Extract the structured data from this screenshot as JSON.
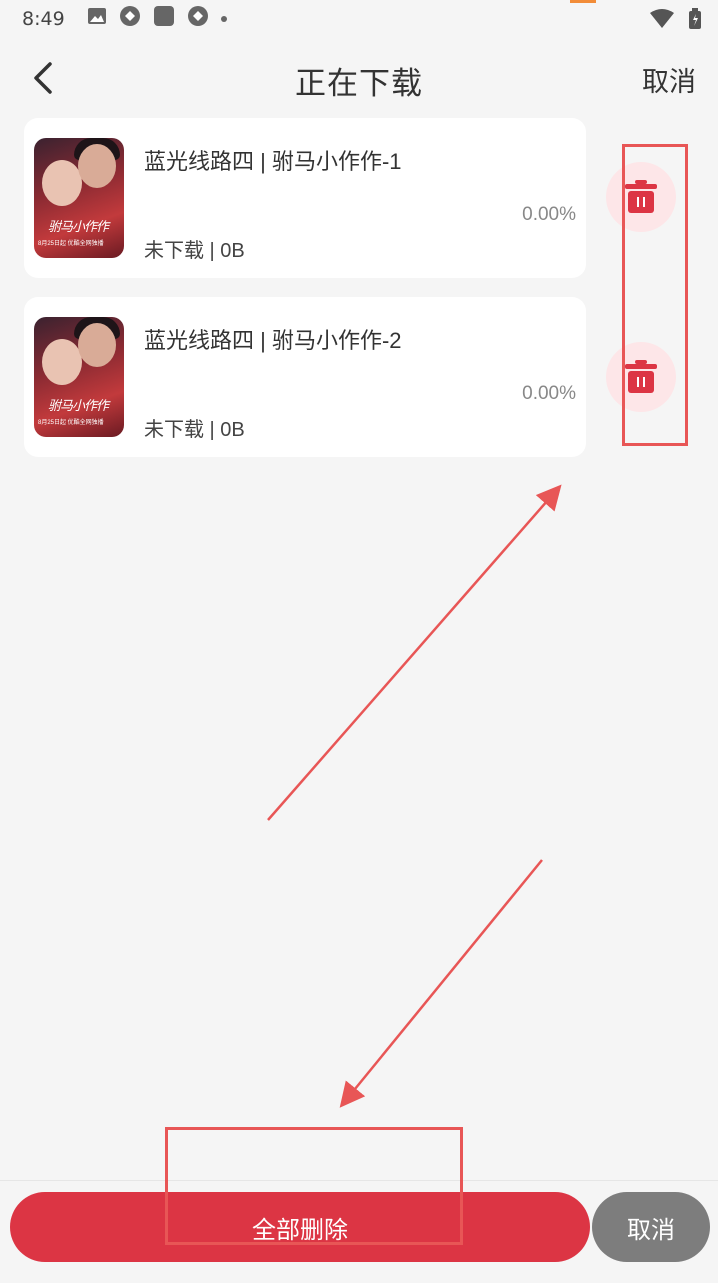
{
  "status_bar": {
    "time": "8:49",
    "icons": [
      "image-icon",
      "app-icon",
      "square-icon",
      "app-icon",
      "dot-icon"
    ],
    "right_icons": [
      "wifi-icon",
      "battery-icon"
    ]
  },
  "header": {
    "back_icon": "chevron-left-icon",
    "title": "正在下载",
    "cancel_label": "取消"
  },
  "downloads": [
    {
      "title": "蓝光线路四 | 驸马小作作-1",
      "status": "未下载 | 0B",
      "progress": "0.00%",
      "thumb_calligraphy": "驸马小作作",
      "thumb_date": "8月25日起 优酷全网独播"
    },
    {
      "title": "蓝光线路四 | 驸马小作作-2",
      "status": "未下载 | 0B",
      "progress": "0.00%",
      "thumb_calligraphy": "驸马小作作",
      "thumb_date": "8月25日起 优酷全网独播"
    }
  ],
  "bottom_bar": {
    "delete_all_label": "全部删除",
    "cancel_label": "取消"
  },
  "colors": {
    "accent_red": "#dc3544",
    "delete_bg": "#fde6e8",
    "annotation": "#e85656",
    "cancel_gray": "#7d7d7d"
  }
}
